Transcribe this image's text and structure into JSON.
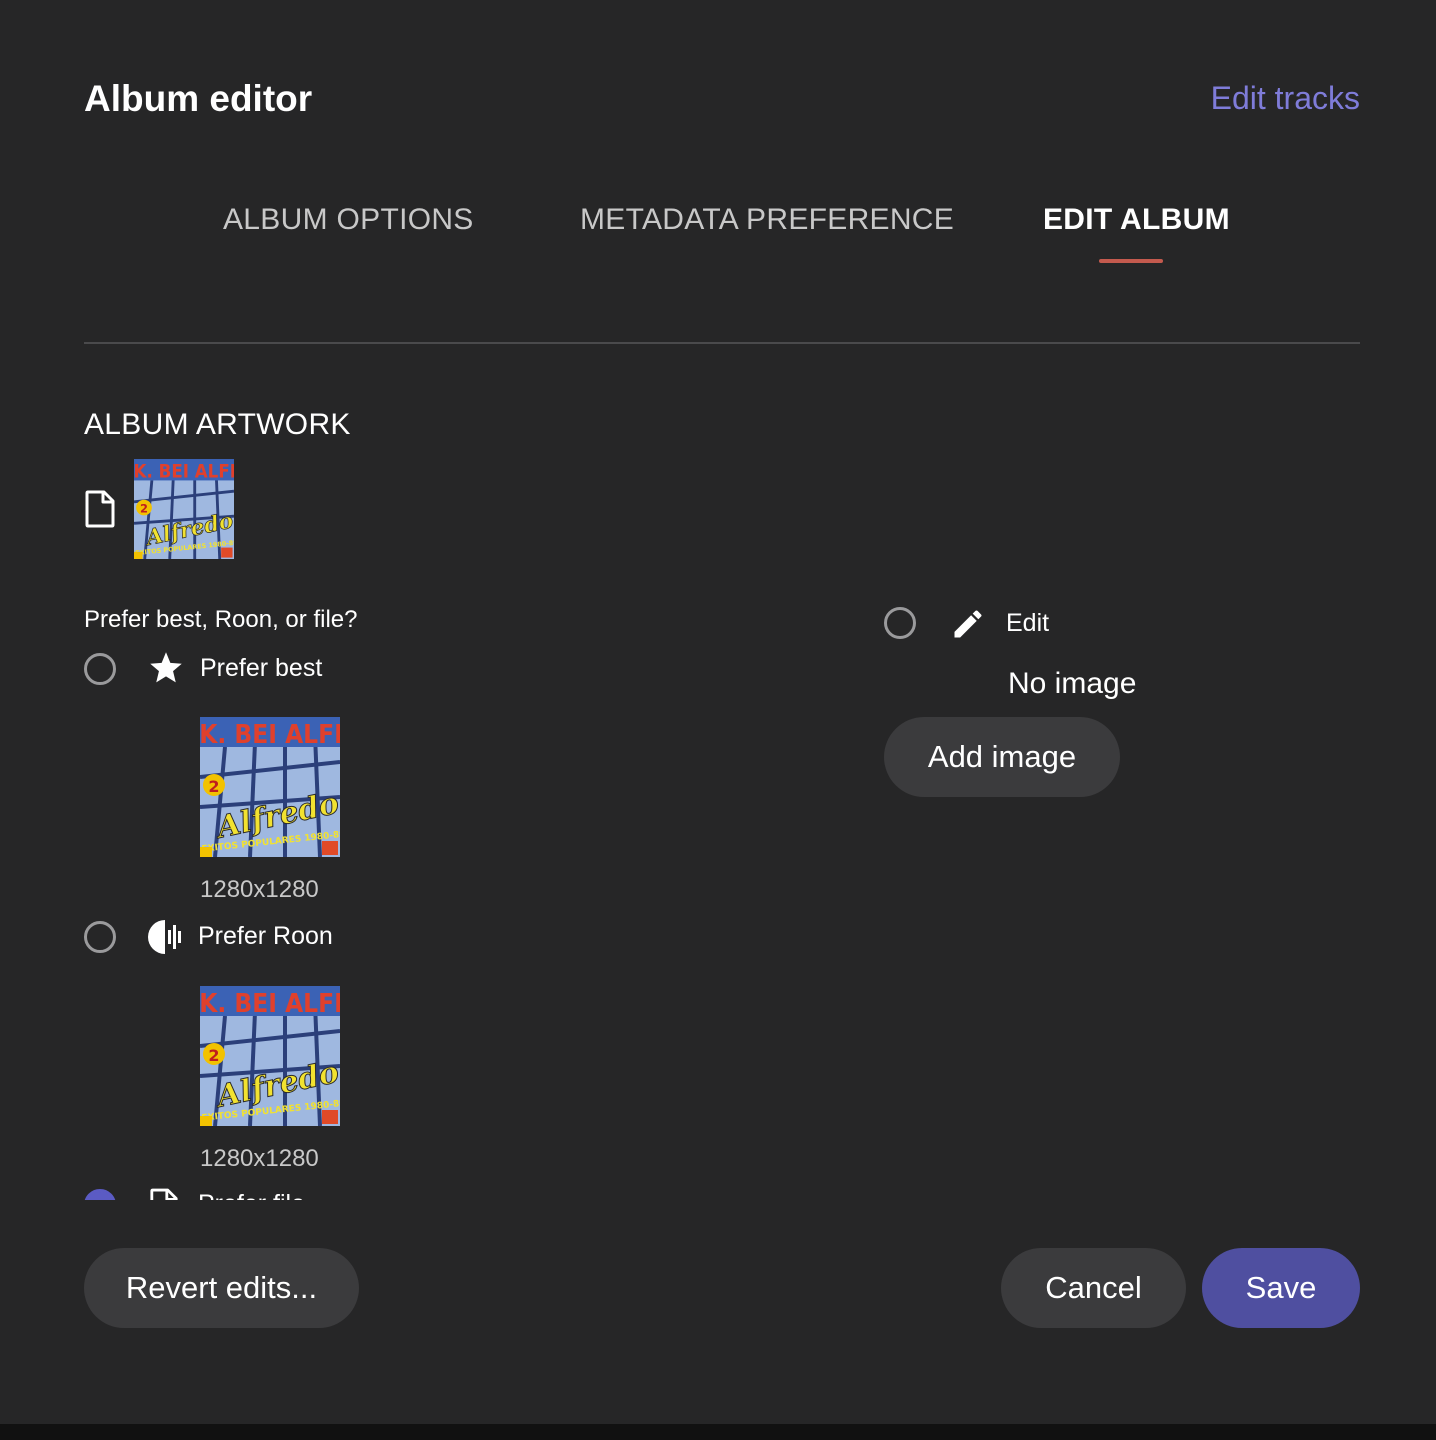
{
  "header": {
    "title": "Album editor",
    "edit_tracks_link": "Edit tracks"
  },
  "tabs": [
    {
      "label": "ALBUM OPTIONS",
      "active": false
    },
    {
      "label": "METADATA PREFERENCE",
      "active": false
    },
    {
      "label": "EDIT ALBUM",
      "active": true
    }
  ],
  "artwork": {
    "section_title": "ALBUM ARTWORK",
    "question": "Prefer best, Roon, or file?",
    "options": [
      {
        "label": "Prefer best",
        "icon": "star-icon",
        "resolution": "1280x1280",
        "selected": false
      },
      {
        "label": "Prefer Roon",
        "icon": "roon-logo-icon",
        "resolution": "1280x1280",
        "selected": false
      },
      {
        "label": "Prefer file",
        "icon": "file-icon",
        "selected": true
      }
    ],
    "edit_option": {
      "label": "Edit",
      "icon": "pencil-icon",
      "selected": false,
      "no_image_text": "No image",
      "add_image_label": "Add image"
    }
  },
  "footer": {
    "revert_label": "Revert edits...",
    "cancel_label": "Cancel",
    "save_label": "Save"
  },
  "colors": {
    "background": "#262627",
    "accent_link": "#7f7cd9",
    "tab_underline": "#c45a4e",
    "primary_button": "#4f4fa0",
    "secondary_button": "#3b3b3d",
    "radio_selected": "#5b5bc4"
  }
}
